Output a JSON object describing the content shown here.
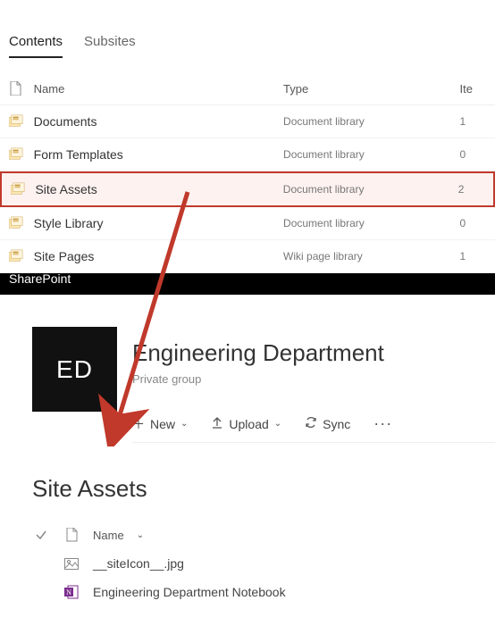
{
  "tabs": {
    "contents": "Contents",
    "subsites": "Subsites"
  },
  "table": {
    "headers": {
      "name": "Name",
      "type": "Type",
      "items": "Ite"
    },
    "rows": [
      {
        "name": "Documents",
        "type": "Document library",
        "items": "1"
      },
      {
        "name": "Form Templates",
        "type": "Document library",
        "items": "0"
      },
      {
        "name": "Site Assets",
        "type": "Document library",
        "items": "2"
      },
      {
        "name": "Style Library",
        "type": "Document library",
        "items": "0"
      },
      {
        "name": "Site Pages",
        "type": "Wiki page library",
        "items": "1"
      }
    ]
  },
  "blackbar": "SharePoint",
  "group": {
    "initials": "ED",
    "title": "Engineering Department",
    "sub": "Private group"
  },
  "toolbar": {
    "new": "New",
    "upload": "Upload",
    "sync": "Sync"
  },
  "section": {
    "title": "Site Assets"
  },
  "filelist": {
    "header": "Name",
    "files": [
      {
        "name": "__siteIcon__.jpg",
        "icon": "image"
      },
      {
        "name": "Engineering Department Notebook",
        "icon": "onenote"
      }
    ]
  }
}
